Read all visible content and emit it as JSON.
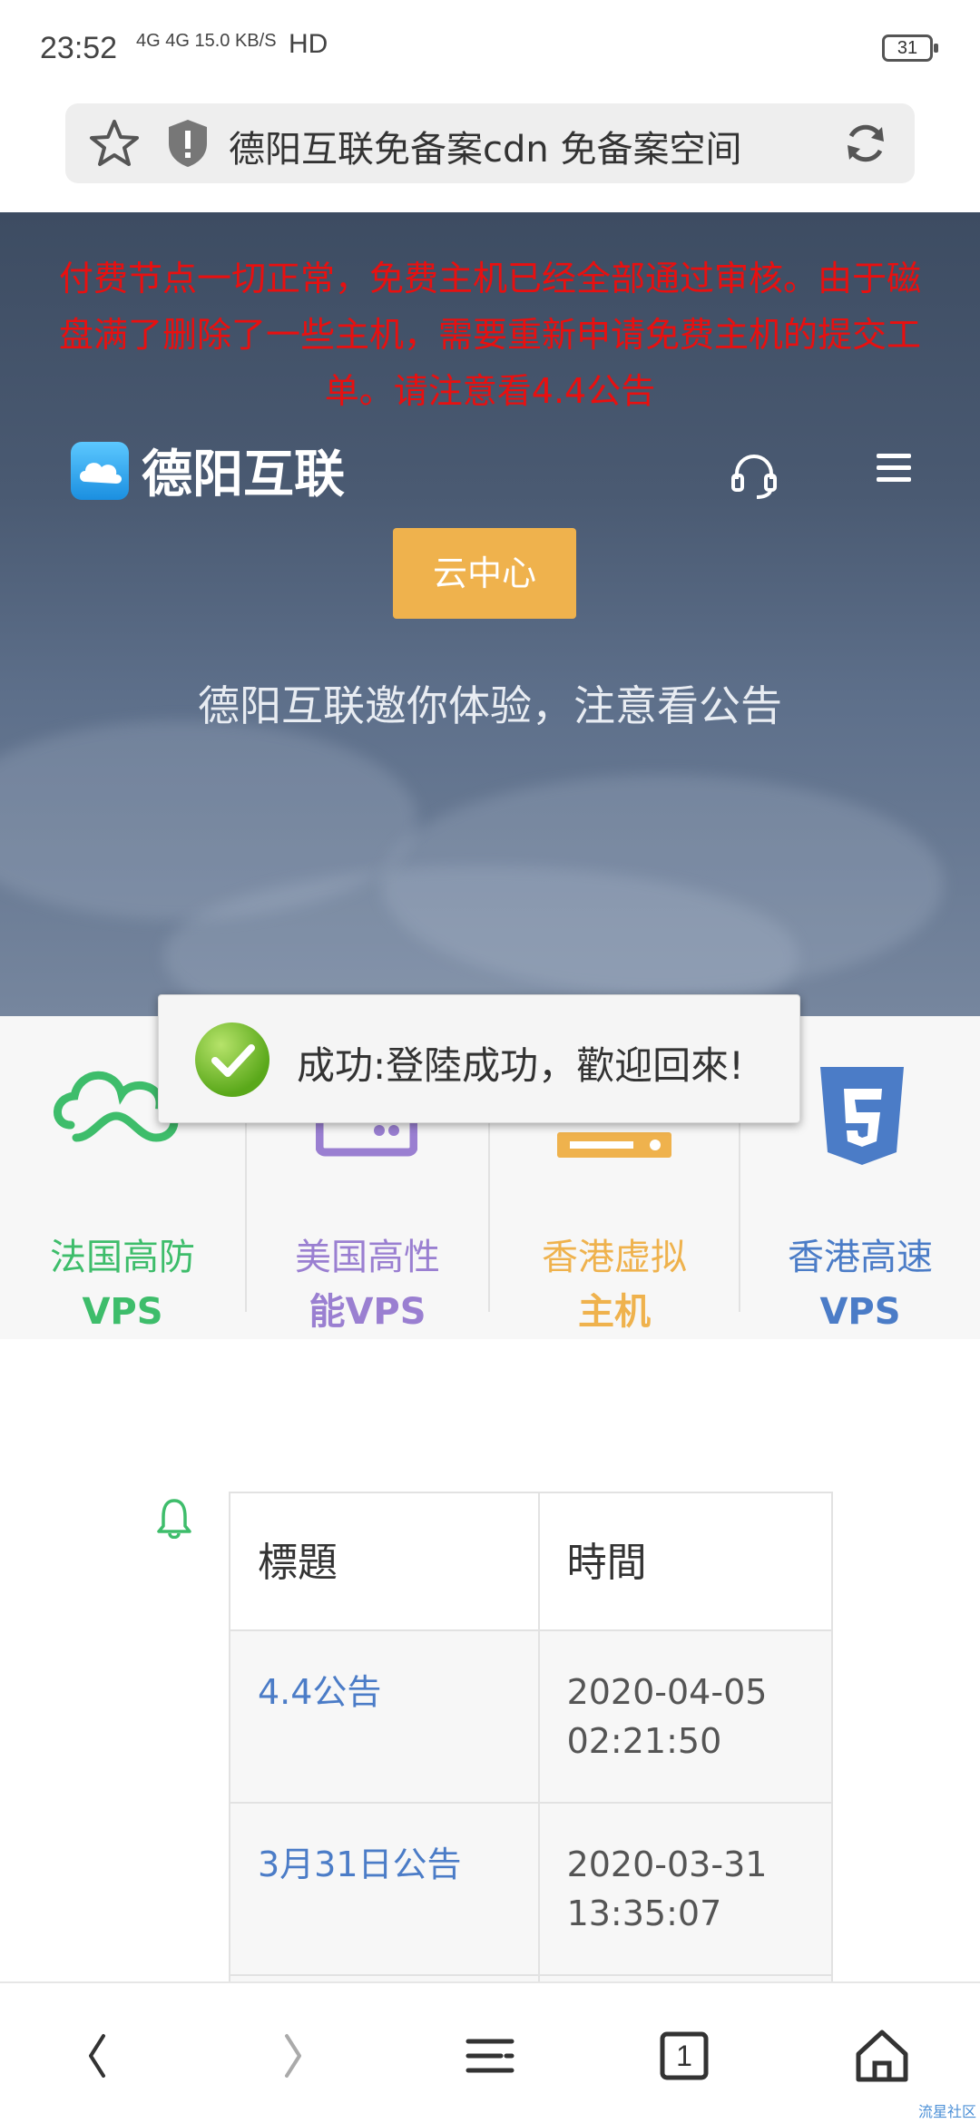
{
  "status_bar": {
    "time": "23:52",
    "network": "4G 4G 15.0 KB/S",
    "hd": "HD",
    "battery": "31"
  },
  "address_bar": {
    "title": "德阳互联免备案cdn 免备案空间"
  },
  "hero": {
    "notice": "付费节点一切正常，免费主机已经全部通过审核。由于磁盘满了删除了一些主机，需要重新申请免费主机的提交工单。请注意看4.4公告",
    "brand_name": "德阳互联",
    "cloud_button": "云中心",
    "subtitle": "德阳互联邀你体验，注意看公告"
  },
  "toast": {
    "message": "成功:登陸成功，歡迎回來!"
  },
  "services": [
    {
      "line1": "法国高防",
      "line2": "VPS",
      "color": "#3ebd6b"
    },
    {
      "line1": "美国高性",
      "line2": "能VPS",
      "color": "#9a7fd1"
    },
    {
      "line1": "香港虚拟",
      "line2": "主机",
      "color": "#efb24d"
    },
    {
      "line1": "香港高速",
      "line2": "VPS",
      "color": "#4b7cc7"
    }
  ],
  "announcements": {
    "headers": [
      "標題",
      "時間"
    ],
    "rows": [
      {
        "title": "4.4公告",
        "time_line1": "2020-04-05",
        "time_line2": "02:21:50"
      },
      {
        "title": "3月31日公告",
        "time_line1": "2020-03-31",
        "time_line2": "13:35:07"
      }
    ]
  },
  "bottom_nav": {
    "tab_count": "1"
  },
  "watermark": "流星社区",
  "colors": {
    "notice_red": "#e81010",
    "accent_orange": "#efb24d",
    "link_blue": "#4b7cc7"
  }
}
